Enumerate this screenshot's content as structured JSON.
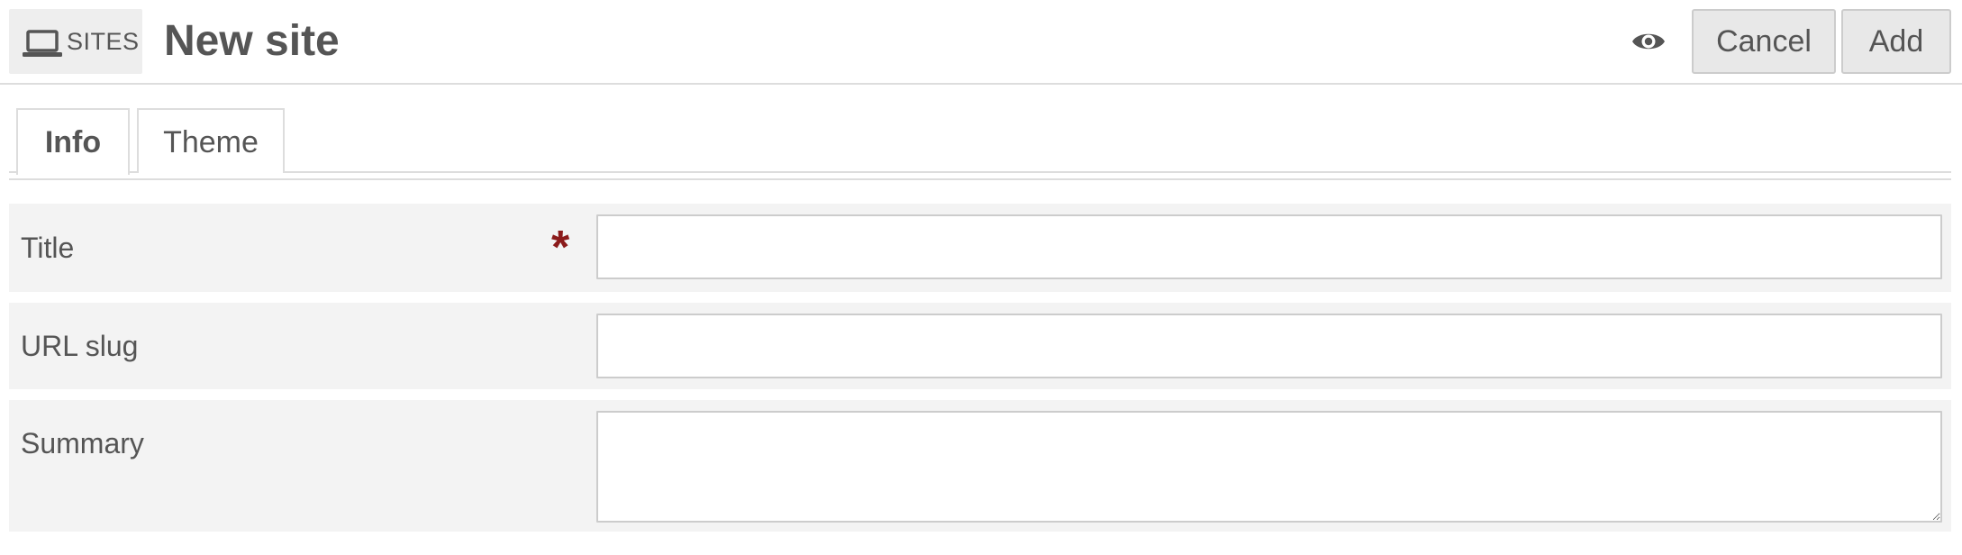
{
  "header": {
    "section": {
      "icon": "laptop-icon",
      "label": "SITES"
    },
    "title": "New site",
    "preview_icon": "eye-icon",
    "cancel_label": "Cancel",
    "add_label": "Add"
  },
  "tabs": [
    {
      "label": "Info",
      "active": true
    },
    {
      "label": "Theme",
      "active": false
    }
  ],
  "form": {
    "title": {
      "label": "Title",
      "required_mark": "*",
      "value": ""
    },
    "url_slug": {
      "label": "URL slug",
      "value": ""
    },
    "summary": {
      "label": "Summary",
      "value": ""
    }
  },
  "colors": {
    "required": "#8b1a1a",
    "row_background": "#f3f3f3",
    "button_background": "#e8e8e8",
    "text": "#555555"
  }
}
